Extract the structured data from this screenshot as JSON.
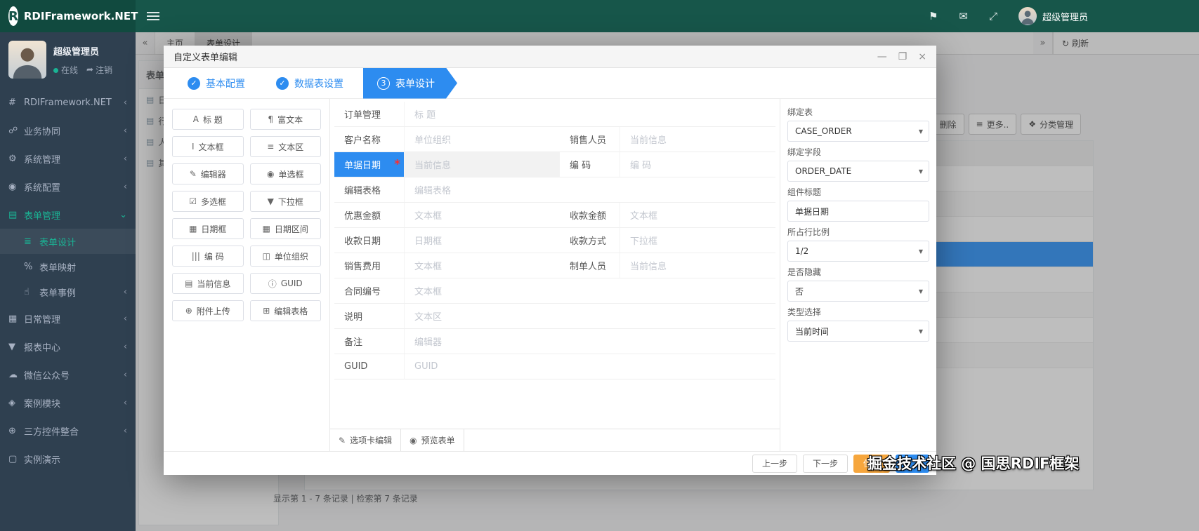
{
  "topbar": {
    "logo_letter": "R",
    "brand": "RDIFramework.NET",
    "user": "超级管理员"
  },
  "icons": {
    "caret": "▼",
    "check": "✓",
    "doc": "▤",
    "refresh": "↻",
    "flag": "⚑",
    "envelope": "✉",
    "expand": "⤢",
    "logout": "➦",
    "minimize": "—",
    "maximize": "❐",
    "close": "×",
    "list": "≡",
    "tag": "❖",
    "edit": "✎",
    "eye": "◉"
  },
  "sidebar": {
    "user_name": "超级管理员",
    "status": "在线",
    "logout": "注销",
    "menu": [
      {
        "icon": "#",
        "label": "RDIFramework.NET",
        "chevron": "‹"
      },
      {
        "icon": "☍",
        "label": "业务协同",
        "chevron": "‹"
      },
      {
        "icon": "⚙",
        "label": "系统管理",
        "chevron": "‹"
      },
      {
        "icon": "◉",
        "label": "系统配置",
        "chevron": "‹"
      },
      {
        "icon": "▤",
        "label": "表单管理",
        "chevron": "⌄"
      },
      {
        "icon": "▦",
        "label": "日常管理",
        "chevron": "‹"
      },
      {
        "icon": "▼",
        "label": "报表中心",
        "chevron": "‹"
      },
      {
        "icon": "☁",
        "label": "微信公众号",
        "chevron": "‹"
      },
      {
        "icon": "◈",
        "label": "案例模块",
        "chevron": "‹"
      },
      {
        "icon": "⊕",
        "label": "三方控件整合",
        "chevron": "‹"
      },
      {
        "icon": "▢",
        "label": "实例演示",
        "chevron": ""
      }
    ],
    "submenu": [
      {
        "icon": "≣",
        "label": "表单设计",
        "chevron": ""
      },
      {
        "icon": "%",
        "label": "表单映射",
        "chevron": ""
      },
      {
        "icon": "☝",
        "label": "表单事例",
        "chevron": "‹"
      }
    ]
  },
  "background": {
    "collapse_left": "«",
    "collapse_right": "»",
    "tabs": [
      {
        "label": "主页"
      },
      {
        "label": "表单设计"
      }
    ],
    "refresh_label": "刷新",
    "panel_title": "表单分",
    "panel_items": [
      "日",
      "行",
      "人",
      "其"
    ],
    "toolbar": [
      {
        "label": "删除"
      },
      {
        "label": "更多.."
      },
      {
        "label": "分类管理"
      }
    ],
    "record_info": "显示第 1 - 7 条记录 | 检索第 7 条记录"
  },
  "modal": {
    "title": "自定义表单编辑",
    "steps": [
      {
        "label": "基本配置"
      },
      {
        "label": "数据表设置"
      },
      {
        "num": "3",
        "label": "表单设计"
      }
    ],
    "palette": [
      {
        "icon": "A",
        "label": "标 题"
      },
      {
        "icon": "¶",
        "label": "富文本"
      },
      {
        "icon": "I",
        "label": "文本框"
      },
      {
        "icon": "≡",
        "label": "文本区"
      },
      {
        "icon": "✎",
        "label": "编辑器"
      },
      {
        "icon": "◉",
        "label": "单选框"
      },
      {
        "icon": "☑",
        "label": "多选框"
      },
      {
        "icon": "▼",
        "label": "下拉框"
      },
      {
        "icon": "▦",
        "label": "日期框"
      },
      {
        "icon": "▦",
        "label": "日期区间"
      },
      {
        "icon": "|||",
        "label": "编 码"
      },
      {
        "icon": "◫",
        "label": "单位组织"
      },
      {
        "icon": "▤",
        "label": "当前信息"
      },
      {
        "icon": "ⓘ",
        "label": "GUID"
      },
      {
        "icon": "⊕",
        "label": "附件上传"
      },
      {
        "icon": "⊞",
        "label": "编辑表格"
      }
    ],
    "required_marker": "*",
    "form_rows": [
      {
        "cells": [
          {
            "label": "订单管理",
            "placeholder": "标 题"
          }
        ]
      },
      {
        "cells": [
          {
            "label": "客户名称",
            "placeholder": "单位组织"
          },
          {
            "label": "销售人员",
            "placeholder": "当前信息"
          }
        ]
      },
      {
        "cells": [
          {
            "label": "单据日期",
            "placeholder": "当前信息"
          },
          {
            "label": "编 码",
            "placeholder": "编 码"
          }
        ]
      },
      {
        "cells": [
          {
            "label": "编辑表格",
            "placeholder": "编辑表格"
          }
        ]
      },
      {
        "cells": [
          {
            "label": "优惠金额",
            "placeholder": "文本框"
          },
          {
            "label": "收款金额",
            "placeholder": "文本框"
          }
        ]
      },
      {
        "cells": [
          {
            "label": "收款日期",
            "placeholder": "日期框"
          },
          {
            "label": "收款方式",
            "placeholder": "下拉框"
          }
        ]
      },
      {
        "cells": [
          {
            "label": "销售费用",
            "placeholder": "文本框"
          },
          {
            "label": "制单人员",
            "placeholder": "当前信息"
          }
        ]
      },
      {
        "cells": [
          {
            "label": "合同编号",
            "placeholder": "文本框"
          }
        ]
      },
      {
        "cells": [
          {
            "label": "说明",
            "placeholder": "文本区"
          }
        ]
      },
      {
        "cells": [
          {
            "label": "备注",
            "placeholder": "编辑器"
          }
        ]
      },
      {
        "cells": [
          {
            "label": "GUID",
            "placeholder": "GUID"
          }
        ]
      }
    ],
    "bottom_tabs": [
      {
        "label": "选项卡编辑"
      },
      {
        "label": "预览表单"
      }
    ],
    "properties": [
      {
        "label": "绑定表",
        "value": "CASE_ORDER"
      },
      {
        "label": "绑定字段",
        "value": "ORDER_DATE"
      },
      {
        "label": "组件标题",
        "value": "单据日期"
      },
      {
        "label": "所占行比例",
        "value": "1/2"
      },
      {
        "label": "是否隐藏",
        "value": "否"
      },
      {
        "label": "类型选择",
        "value": "当前时间"
      }
    ],
    "footer_buttons": [
      {
        "label": "上一步"
      },
      {
        "label": "下一步"
      },
      {
        "label": "保存"
      },
      {
        "label": ""
      }
    ]
  },
  "watermark": "掘金技术社区 @ 国思RDIF框架",
  "colors": {
    "topbar_green": "#17564a",
    "sidebar_dark": "#2f4050",
    "accent_green": "#1ab394",
    "accent_blue": "#2d8cf0",
    "warning_orange": "#f6a63d",
    "selected_row_blue": "#3f9bfa"
  }
}
